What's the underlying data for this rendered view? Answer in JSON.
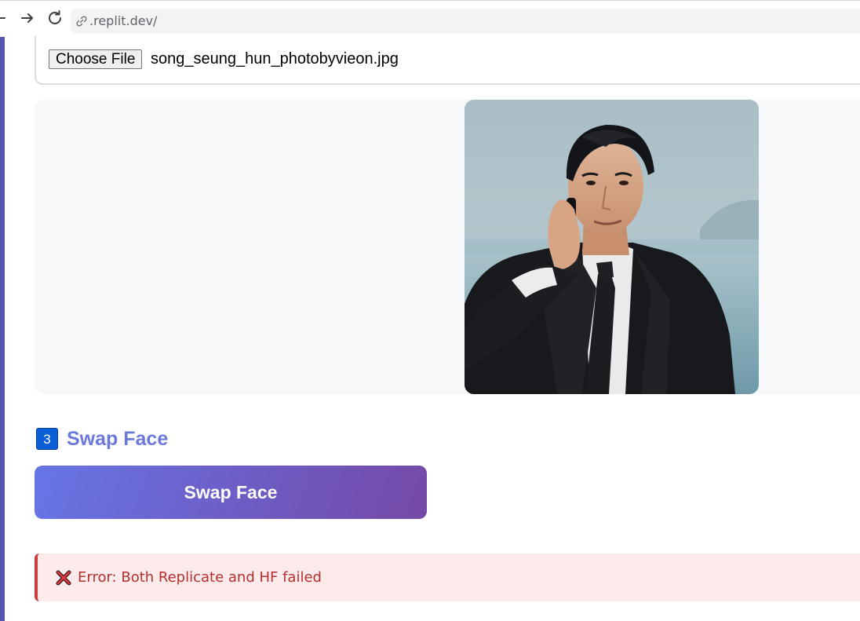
{
  "browser": {
    "url": ".replit.dev/"
  },
  "upload": {
    "choose_file_label": "Choose File",
    "file_name": "song_seung_hun_photobyvieon.jpg"
  },
  "swap_section": {
    "step_number": "3",
    "step_title": "Swap Face",
    "button_label": "Swap Face"
  },
  "error": {
    "icon": "cross-mark-icon",
    "message": "Error: Both Replicate and HF failed"
  },
  "colors": {
    "accent": "#6b78dc",
    "button_gradient_start": "#6676e6",
    "button_gradient_end": "#7549a6",
    "error_text": "#b52f2f",
    "error_background": "#fdebeb"
  }
}
